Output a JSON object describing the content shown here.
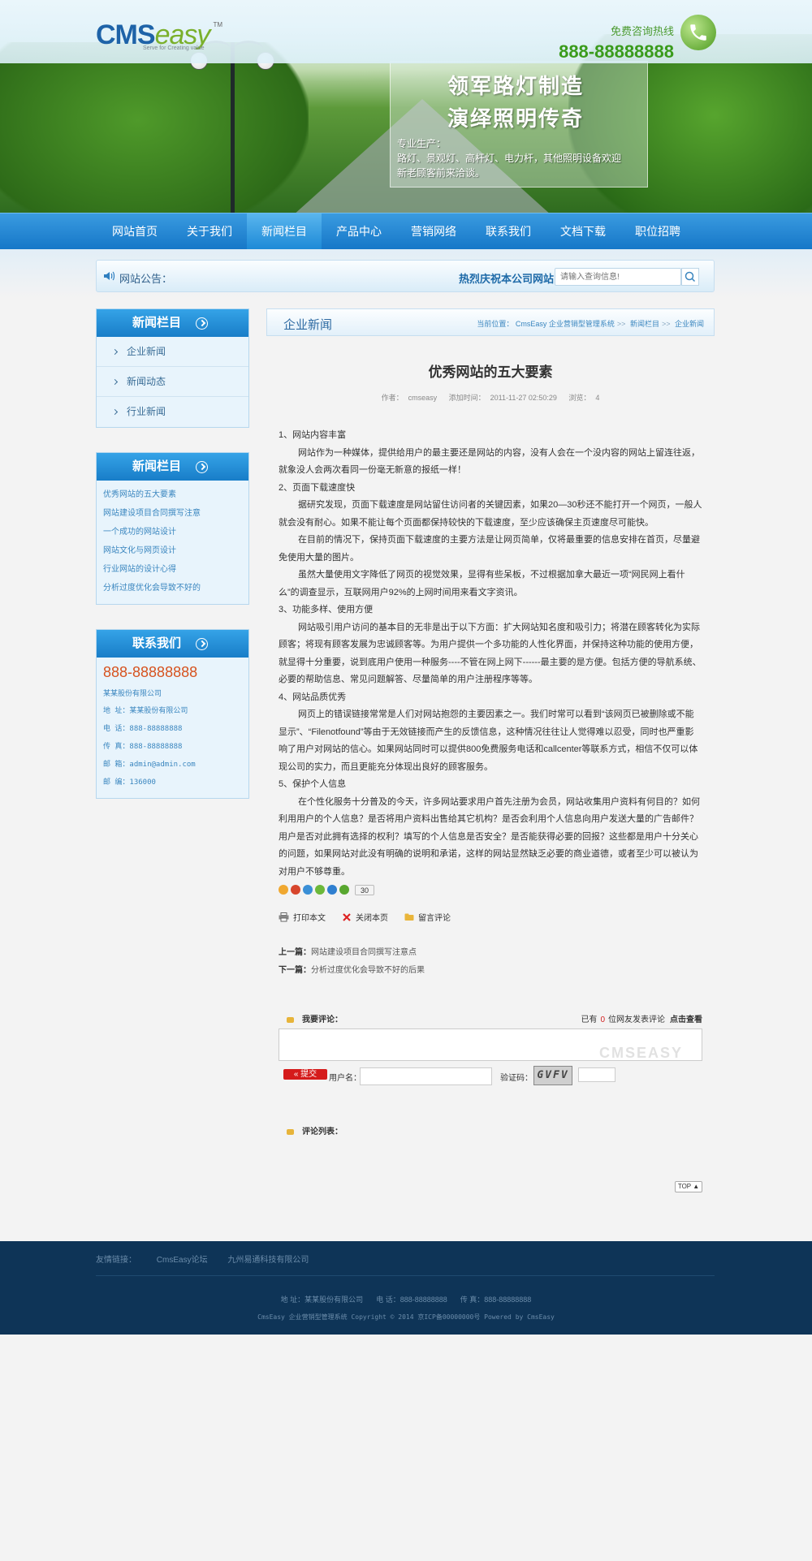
{
  "header": {
    "logo_main": "CMS",
    "logo_sub": "easy",
    "logo_tm": "TM",
    "logo_slogan": "Serve for Creating value",
    "hotline_label": "免费咨询热线",
    "hotline_number": "888-88888888"
  },
  "banner": {
    "headline_1": "领军路灯制造",
    "headline_2": "演绎照明传奇",
    "desc_1": "专业生产：",
    "desc_2": "路灯、景观灯、高杆灯、电力杆，其他照明设备欢迎",
    "desc_3": "新老顾客前来洽谈。"
  },
  "nav": {
    "items": [
      {
        "label": "网站首页"
      },
      {
        "label": "关于我们"
      },
      {
        "label": "新闻栏目"
      },
      {
        "label": "产品中心"
      },
      {
        "label": "营销网络"
      },
      {
        "label": "联系我们"
      },
      {
        "label": "文档下载"
      },
      {
        "label": "职位招聘"
      }
    ],
    "active_index": 2
  },
  "notice": {
    "title": "网站公告：",
    "message": "热烈庆祝本公司网站",
    "search_placeholder": "请输入查询信息!"
  },
  "sidebar": {
    "categories_title": "新闻栏目",
    "categories": [
      "企业新闻",
      "新闻动态",
      "行业新闻"
    ],
    "news_title": "新闻栏目",
    "news": [
      "优秀网站的五大要素",
      "网站建设项目合同撰写注意",
      "一个成功的网站设计",
      "网站文化与网页设计",
      "行业网站的设计心得",
      "分析过度优化会导致不好的"
    ],
    "contact_title": "联系我们",
    "contact_phone": "888-88888888",
    "contact_company": "某某股份有限公司",
    "contact_rows": [
      {
        "label": "地 址：",
        "value": "某某股份有限公司"
      },
      {
        "label": "电 话：",
        "value": "888-88888888"
      },
      {
        "label": "传 真：",
        "value": "888-88888888"
      },
      {
        "label": "邮 箱：",
        "value": "admin@admin.com"
      },
      {
        "label": "邮 编：",
        "value": "136000"
      }
    ]
  },
  "crumb": {
    "section": "企业新闻",
    "prefix": "当前位置：",
    "path": [
      "CmsEasy 企业营销型管理系统",
      "新闻栏目",
      "企业新闻"
    ]
  },
  "article": {
    "title": "优秀网站的五大要素",
    "author_label": "作者：",
    "author": "cmseasy",
    "date_label": "添加时间：",
    "date": "2011-11-27 02:50:29",
    "views_label": "浏览：",
    "views": "4",
    "paragraphs": [
      {
        "t": "1、网站内容丰富",
        "ind": false
      },
      {
        "t": "网站作为一种媒体，提供给用户的最主要还是网站的内容，没有人会在一个没内容的网站上留连往返，就象没人会两次看同一份毫无新意的报纸一样！",
        "ind": true
      },
      {
        "t": "2、页面下载速度快",
        "ind": false
      },
      {
        "t": "据研究发现，页面下载速度是网站留住访问者的关键因素，如果20—30秒还不能打开一个网页，一般人就会没有耐心。如果不能让每个页面都保持较快的下载速度，至少应该确保主页速度尽可能快。",
        "ind": true
      },
      {
        "t": "在目前的情况下，保持页面下载速度的主要方法是让网页简单，仅将最重要的信息安排在首页，尽量避免使用大量的图片。",
        "ind": true
      },
      {
        "t": "虽然大量使用文字降低了网页的视觉效果，显得有些呆板，不过根据加拿大最近一项“网民网上看什么”的调查显示，互联网用户92%的上网时间用来看文字资讯。",
        "ind": true
      },
      {
        "t": "3、功能多样、使用方便",
        "ind": false
      },
      {
        "t": "网站吸引用户访问的基本目的无非是出于以下方面：扩大网站知名度和吸引力；将潜在顾客转化为实际顾客；将现有顾客发展为忠诚顾客等。为用户提供一个多功能的人性化界面，并保持这种功能的使用方便，就显得十分重要，说到底用户使用一种服务----不管在网上网下------最主要的是方便。包括方便的导航系统、必要的帮助信息、常见问题解答、尽量简单的用户注册程序等等。",
        "ind": true
      },
      {
        "t": "4、网站品质优秀",
        "ind": false
      },
      {
        "t": "网页上的错误链接常常是人们对网站抱怨的主要因素之一。我们时常可以看到“该网页已被删除或不能显示”、“Filenotfound”等由于无效链接而产生的反馈信息，这种情况往往让人觉得难以忍受，同时也严重影响了用户对网站的信心。如果网站同时可以提供800免费服务电话和callcenter等联系方式，相信不仅可以体现公司的实力，而且更能充分体现出良好的顾客服务。",
        "ind": true
      },
      {
        "t": "5、保护个人信息",
        "ind": false
      },
      {
        "t": "在个性化服务十分普及的今天，许多网站要求用户首先注册为会员，网站收集用户资料有何目的？如何利用用户的个人信息？是否将用户资料出售给其它机构？是否会利用个人信息向用户发送大量的广告邮件？用户是否对此拥有选择的权利？填写的个人信息是否安全？是否能获得必要的回报？这些都是用户十分关心的问题，如果网站对此没有明确的说明和承诺，这样的网站显然缺乏必要的商业道德，或者至少可以被认为对用户不够尊重。",
        "ind": true
      }
    ]
  },
  "share": {
    "count": "30",
    "colors": [
      "#f0a830",
      "#d7452c",
      "#3a8fd6",
      "#6cb83a",
      "#2f7fd0",
      "#58a72f"
    ]
  },
  "tools": {
    "print": "打印本文",
    "close": "关闭本页",
    "comment": "留言评论"
  },
  "prevnext": {
    "prev_label": "上一篇：",
    "prev": "网站建设项目合同撰写注意点",
    "next_label": "下一篇：",
    "next": "分析过度优化会导致不好的后果"
  },
  "comment": {
    "title": "我要评论：",
    "count_prefix": "已有",
    "count": "0",
    "count_suffix": "位网友发表评论",
    "view": "点击查看",
    "watermark": "CMSEASY",
    "submit": "提交",
    "user_label": "用户名：",
    "captcha_label": "验证码：",
    "captcha": "GVFV",
    "list_title": "评论列表："
  },
  "top_button": "TOP",
  "footer": {
    "links_label": "友情链接：",
    "links": [
      "CmsEasy论坛",
      "九州易通科技有限公司"
    ],
    "address": "地 址：某某股份有限公司",
    "phone": "电 话：888-88888888",
    "fax": "传 真：888-88888888",
    "copyright": "CmsEasy 企业营销型管理系统 Copyright © 2014 京ICP备00000000号 Powered by CmsEasy"
  }
}
